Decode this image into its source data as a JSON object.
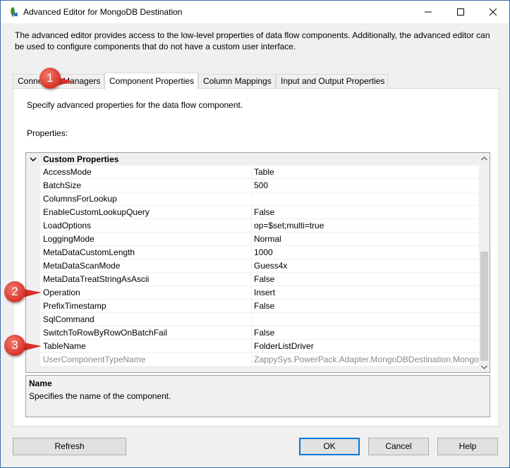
{
  "window": {
    "title": "Advanced Editor for MongoDB Destination",
    "description": "The advanced editor provides access to the low-level properties of data flow components. Additionally, the advanced editor can be used to configure components that do not have a custom user interface."
  },
  "tabs": [
    {
      "label": "Connection Managers",
      "active": false
    },
    {
      "label": "Component Properties",
      "active": true
    },
    {
      "label": "Column Mappings",
      "active": false
    },
    {
      "label": "Input and Output Properties",
      "active": false
    }
  ],
  "tab_page": {
    "description": "Specify advanced properties for the data flow component.",
    "properties_label": "Properties:"
  },
  "grid": {
    "category": "Custom Properties",
    "rows": [
      {
        "name": "AccessMode",
        "value": "Table"
      },
      {
        "name": "BatchSize",
        "value": "500"
      },
      {
        "name": "ColumnsForLookup",
        "value": ""
      },
      {
        "name": "EnableCustomLookupQuery",
        "value": "False"
      },
      {
        "name": "LoadOptions",
        "value": "op=$set;multi=true"
      },
      {
        "name": "LoggingMode",
        "value": "Normal"
      },
      {
        "name": "MetaDataCustomLength",
        "value": "1000"
      },
      {
        "name": "MetaDataScanMode",
        "value": "Guess4x"
      },
      {
        "name": "MetaDataTreatStringAsAscii",
        "value": "False"
      },
      {
        "name": "Operation",
        "value": "Insert"
      },
      {
        "name": "PrefixTimestamp",
        "value": "False"
      },
      {
        "name": "SqlCommand",
        "value": ""
      },
      {
        "name": "SwitchToRowByRowOnBatchFail",
        "value": "False"
      },
      {
        "name": "TableName",
        "value": "FolderListDriver"
      },
      {
        "name": "UserComponentTypeName",
        "value": "ZappySys.PowerPack.Adapter.MongoDBDestination.MongoDBDestination"
      }
    ]
  },
  "help": {
    "title": "Name",
    "text": "Specifies the name of the component."
  },
  "buttons": {
    "refresh": "Refresh",
    "ok": "OK",
    "cancel": "Cancel",
    "help": "Help"
  },
  "badges": [
    "1",
    "2",
    "3"
  ],
  "colors": {
    "badge": "#d9322a",
    "focus_border": "#0078d7"
  }
}
